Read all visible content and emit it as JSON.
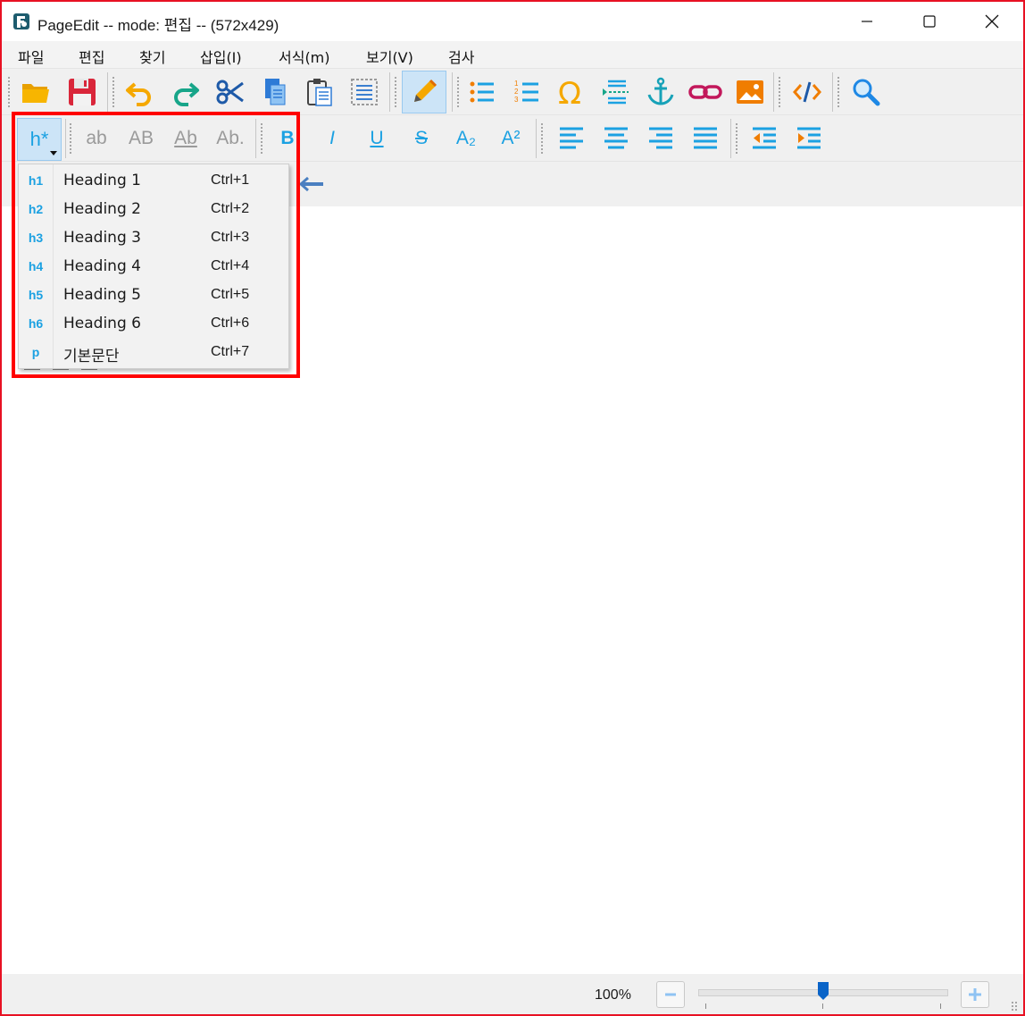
{
  "window": {
    "title": "PageEdit -- mode: 편집 -- (572x429)",
    "controls": [
      "minimize",
      "maximize",
      "close"
    ]
  },
  "menu": [
    "파일",
    "편집",
    "찾기",
    "삽입(I)",
    "서식(m)",
    "보기(V)",
    "검사"
  ],
  "toolbar1": {
    "buttons": [
      "open-icon",
      "save-icon",
      "undo-icon",
      "redo-icon",
      "cut-icon",
      "copy-icon",
      "paste-icon",
      "select-all-icon",
      "edit-mode-icon",
      "bullet-list-icon",
      "numbered-list-icon",
      "special-char-icon",
      "insert-break-icon",
      "anchor-icon",
      "link-icon",
      "image-icon",
      "code-view-icon",
      "search-icon"
    ]
  },
  "toolbar2": {
    "heading_button": "h*",
    "case_buttons": [
      "ab",
      "AB",
      "Ab",
      "Ab."
    ],
    "format_buttons": [
      "B",
      "I",
      "U",
      "S",
      "A₂",
      "A²"
    ]
  },
  "heading_menu": [
    {
      "tag": "h1",
      "label": "Heading 1",
      "shortcut": "Ctrl+1"
    },
    {
      "tag": "h2",
      "label": "Heading 2",
      "shortcut": "Ctrl+2"
    },
    {
      "tag": "h3",
      "label": "Heading 3",
      "shortcut": "Ctrl+3"
    },
    {
      "tag": "h4",
      "label": "Heading 4",
      "shortcut": "Ctrl+4"
    },
    {
      "tag": "h5",
      "label": "Heading 5",
      "shortcut": "Ctrl+5"
    },
    {
      "tag": "h6",
      "label": "Heading 6",
      "shortcut": "Ctrl+6"
    },
    {
      "tag": "p",
      "label": "기본문단",
      "shortcut": "Ctrl+7"
    }
  ],
  "status": {
    "zoom": "100%",
    "zoom_fraction": 0.5
  },
  "colors": {
    "accent": "#1ba1e2",
    "highlight_border": "#ff0000",
    "window_border": "#e81123"
  }
}
